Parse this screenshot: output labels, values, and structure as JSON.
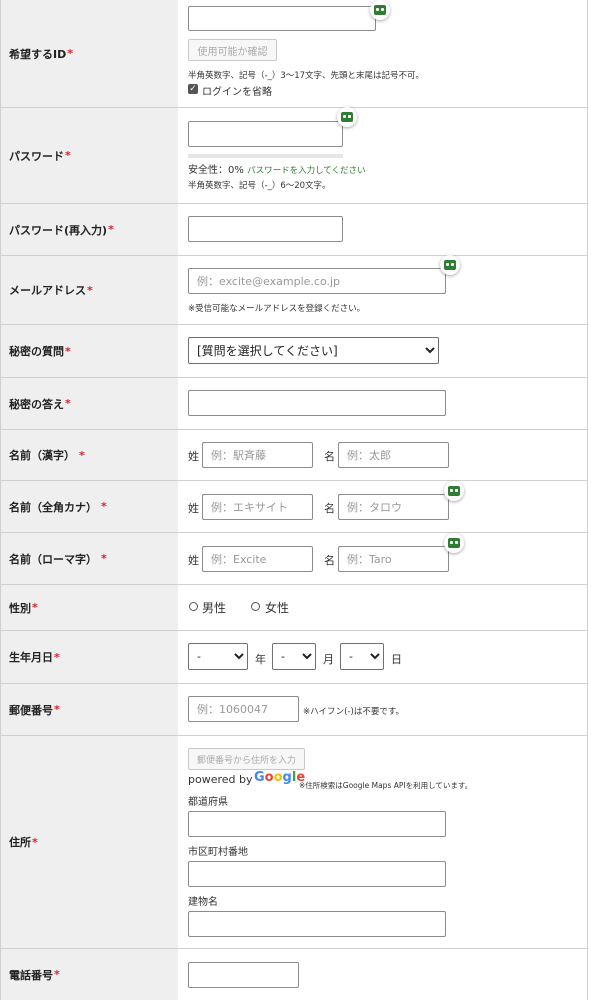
{
  "fields": {
    "desired_id": {
      "label": "希望するID",
      "required_mark": "*",
      "check_button": "使用可能か確認",
      "note": "半角英数字、記号（-_）3〜17文字、先頭と末尾は記号不可。",
      "skip_login_label": "ログインを省略"
    },
    "password": {
      "label": "パスワード",
      "required_mark": "*",
      "strength_label": "安全性：0%",
      "strength_hint": "パスワードを入力してください",
      "strength_value": 0,
      "note": "半角英数字、記号（-_）6〜20文字。"
    },
    "password_confirm": {
      "label": "パスワード(再入力)",
      "required_mark": "*"
    },
    "email": {
      "label": "メールアドレス",
      "required_mark": "*",
      "placeholder": "例：excite@example.co.jp",
      "note": "※受信可能なメールアドレスを登録ください。"
    },
    "secret_question": {
      "label": "秘密の質問",
      "required_mark": "*",
      "selected": "[質問を選択してください]"
    },
    "secret_answer": {
      "label": "秘密の答え",
      "required_mark": "*"
    },
    "name_kanji": {
      "label": "名前（漢字）",
      "required_mark": "*",
      "sei_label": "姓",
      "mei_label": "名",
      "sei_placeholder": "例：駅斉藤",
      "mei_placeholder": "例：太郎"
    },
    "name_kana": {
      "label": "名前（全角カナ）",
      "required_mark": "*",
      "sei_label": "姓",
      "mei_label": "名",
      "sei_placeholder": "例：エキサイト",
      "mei_placeholder": "例：タロウ"
    },
    "name_roman": {
      "label": "名前（ローマ字）",
      "required_mark": "*",
      "sei_label": "姓",
      "mei_label": "名",
      "sei_placeholder": "例：Excite",
      "mei_placeholder": "例：Taro"
    },
    "gender": {
      "label": "性別",
      "required_mark": "*",
      "male": "男性",
      "female": "女性"
    },
    "birthdate": {
      "label": "生年月日",
      "required_mark": "*",
      "year_value": "-",
      "month_value": "-",
      "day_value": "-",
      "year_unit": "年",
      "month_unit": "月",
      "day_unit": "日"
    },
    "postal_code": {
      "label": "郵便番号",
      "required_mark": "*",
      "placeholder": "例：1060047",
      "note": "※ハイフン(-)は不要です。"
    },
    "address": {
      "label": "住所",
      "required_mark": "*",
      "lookup_button": "郵便番号から住所を入力",
      "powered_by": "powered by",
      "google": "Google",
      "google_note": "※住所検索はGoogle Maps APIを利用しています。",
      "prefecture_label": "都道府県",
      "city_label": "市区町村番地",
      "building_label": "建物名"
    },
    "phone": {
      "label": "電話番号",
      "required_mark": "*"
    }
  },
  "colors": {
    "label_bg": "#efefef",
    "required": "#d9232d",
    "hint_green": "#2e7d32",
    "google_blue": "#4285F4",
    "google_red": "#EA4335",
    "google_yellow": "#FBBC05",
    "google_green": "#34A853"
  },
  "icons": {
    "password_manager": "password-manager-icon",
    "checkbox": "check-icon"
  }
}
